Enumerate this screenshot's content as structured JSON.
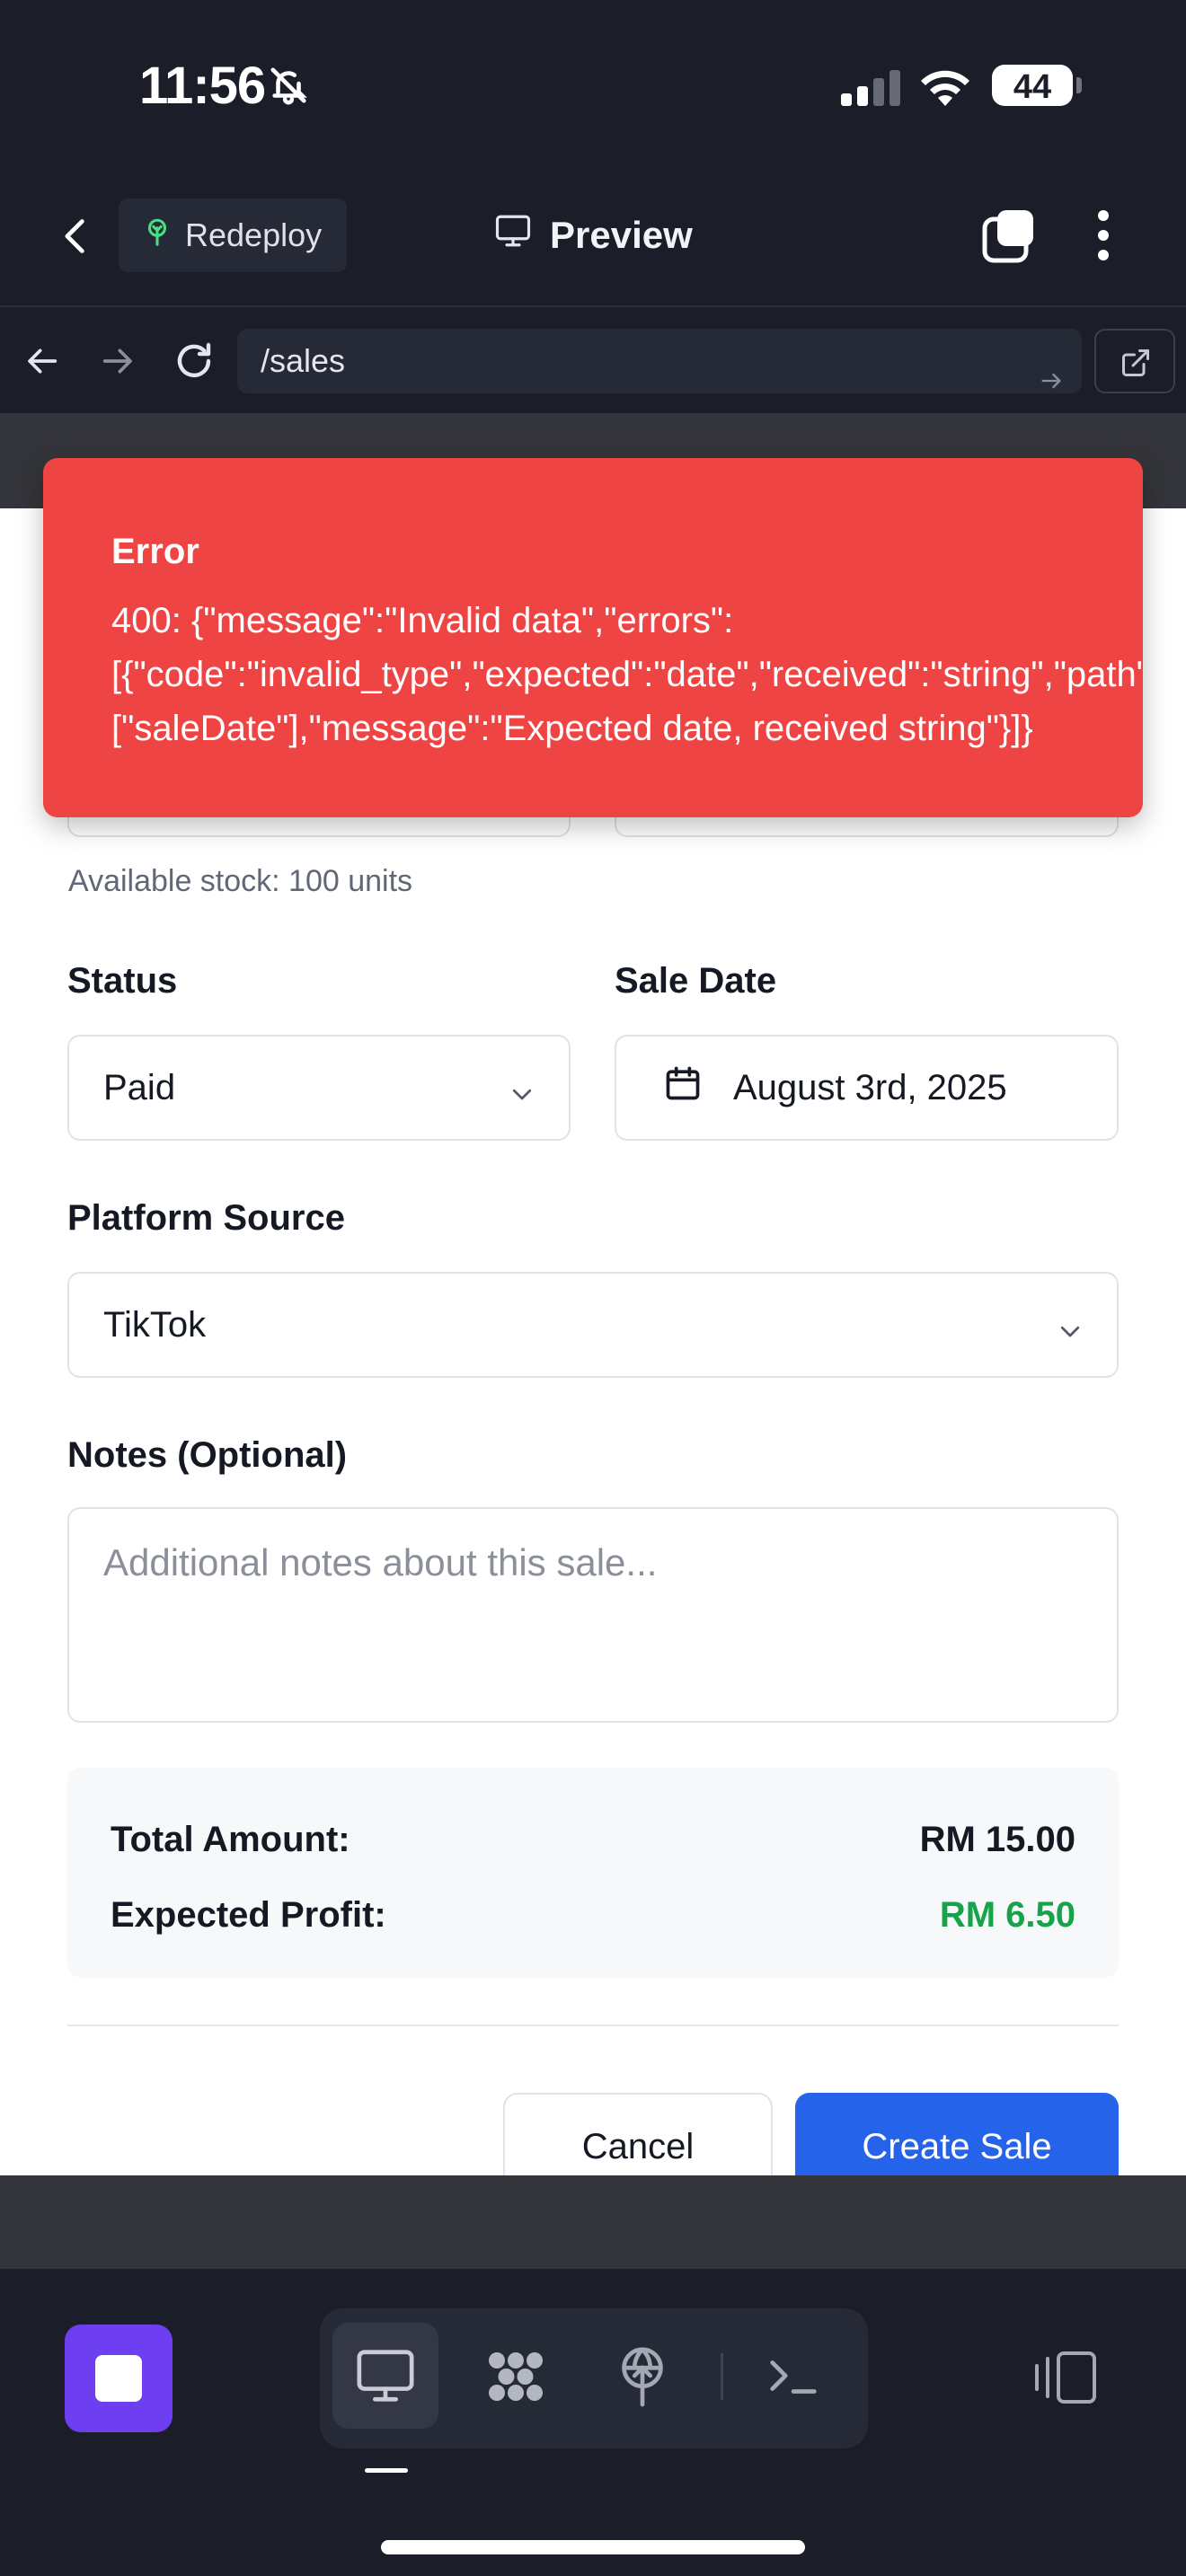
{
  "status_bar": {
    "time": "11:56",
    "battery": "44"
  },
  "header": {
    "redeploy_label": "Redeploy",
    "preview_label": "Preview"
  },
  "urlbar": {
    "url": "/sales"
  },
  "form": {
    "stock_hint": "Available stock: 100 units",
    "status_label": "Status",
    "status_value": "Paid",
    "sale_date_label": "Sale Date",
    "sale_date_value": "August 3rd, 2025",
    "platform_label": "Platform Source",
    "platform_value": "TikTok",
    "notes_label": "Notes (Optional)",
    "notes_placeholder": "Additional notes about this sale...",
    "summary": {
      "total_label": "Total Amount:",
      "total_value": "RM 15.00",
      "profit_label": "Expected Profit:",
      "profit_value": "RM 6.50"
    },
    "cancel_label": "Cancel",
    "create_label": "Create Sale"
  },
  "toast": {
    "title": "Error",
    "line1": "400: {\"message\":\"Invalid data\",\"errors\":",
    "line2": "[{\"code\":\"invalid_type\",\"expected\":\"date\",\"received\":\"string\",\"path\":",
    "line3": "[\"saleDate\"],\"message\":\"Expected date, received string\"}]}"
  },
  "colors": {
    "error": "#ef4444",
    "primary": "#2563eb",
    "profit": "#16a34a",
    "stop": "#6d3ff0"
  },
  "icons": [
    "bell-slash-icon",
    "cellular-icon",
    "wifi-icon",
    "battery-icon",
    "chevron-left-icon",
    "tree-icon",
    "monitor-icon",
    "tabs-icon",
    "kebab-icon",
    "arrow-left-icon",
    "arrow-right-icon",
    "reload-icon",
    "external-link-icon",
    "chevron-down-icon",
    "calendar-icon",
    "stop-icon",
    "desktop-icon",
    "apps-icon",
    "deploy-icon",
    "terminal-icon",
    "sidebar-icon"
  ]
}
